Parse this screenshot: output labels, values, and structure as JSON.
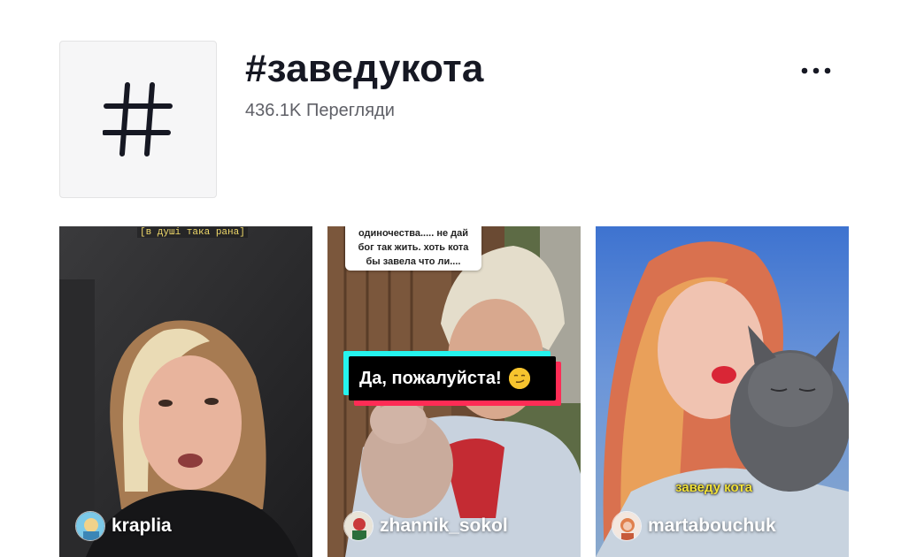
{
  "header": {
    "title": "#заведукота",
    "views": "436.1K Перегляди",
    "cover_icon": "hashtag-icon",
    "more_icon": "more-horizontal-icon"
  },
  "videos": [
    {
      "author": "kraplia",
      "overlay_text": "[в душі така рана]"
    },
    {
      "author": "zhannik_sokol",
      "bubble_lines": [
        "одиночества..... не дай",
        "бог так жить. хоть кота",
        "бы завела что ли...."
      ],
      "sticker_text": "Да, пожалуйста!",
      "sticker_emoji": "smirk-emoji-icon"
    },
    {
      "author": "martabouchuk",
      "overlay_text": "заведу кота"
    }
  ],
  "colors": {
    "text_primary": "#161823",
    "text_secondary": "#5f6067",
    "tiktok_cyan": "#25f4ee",
    "tiktok_red": "#fe2c55"
  }
}
